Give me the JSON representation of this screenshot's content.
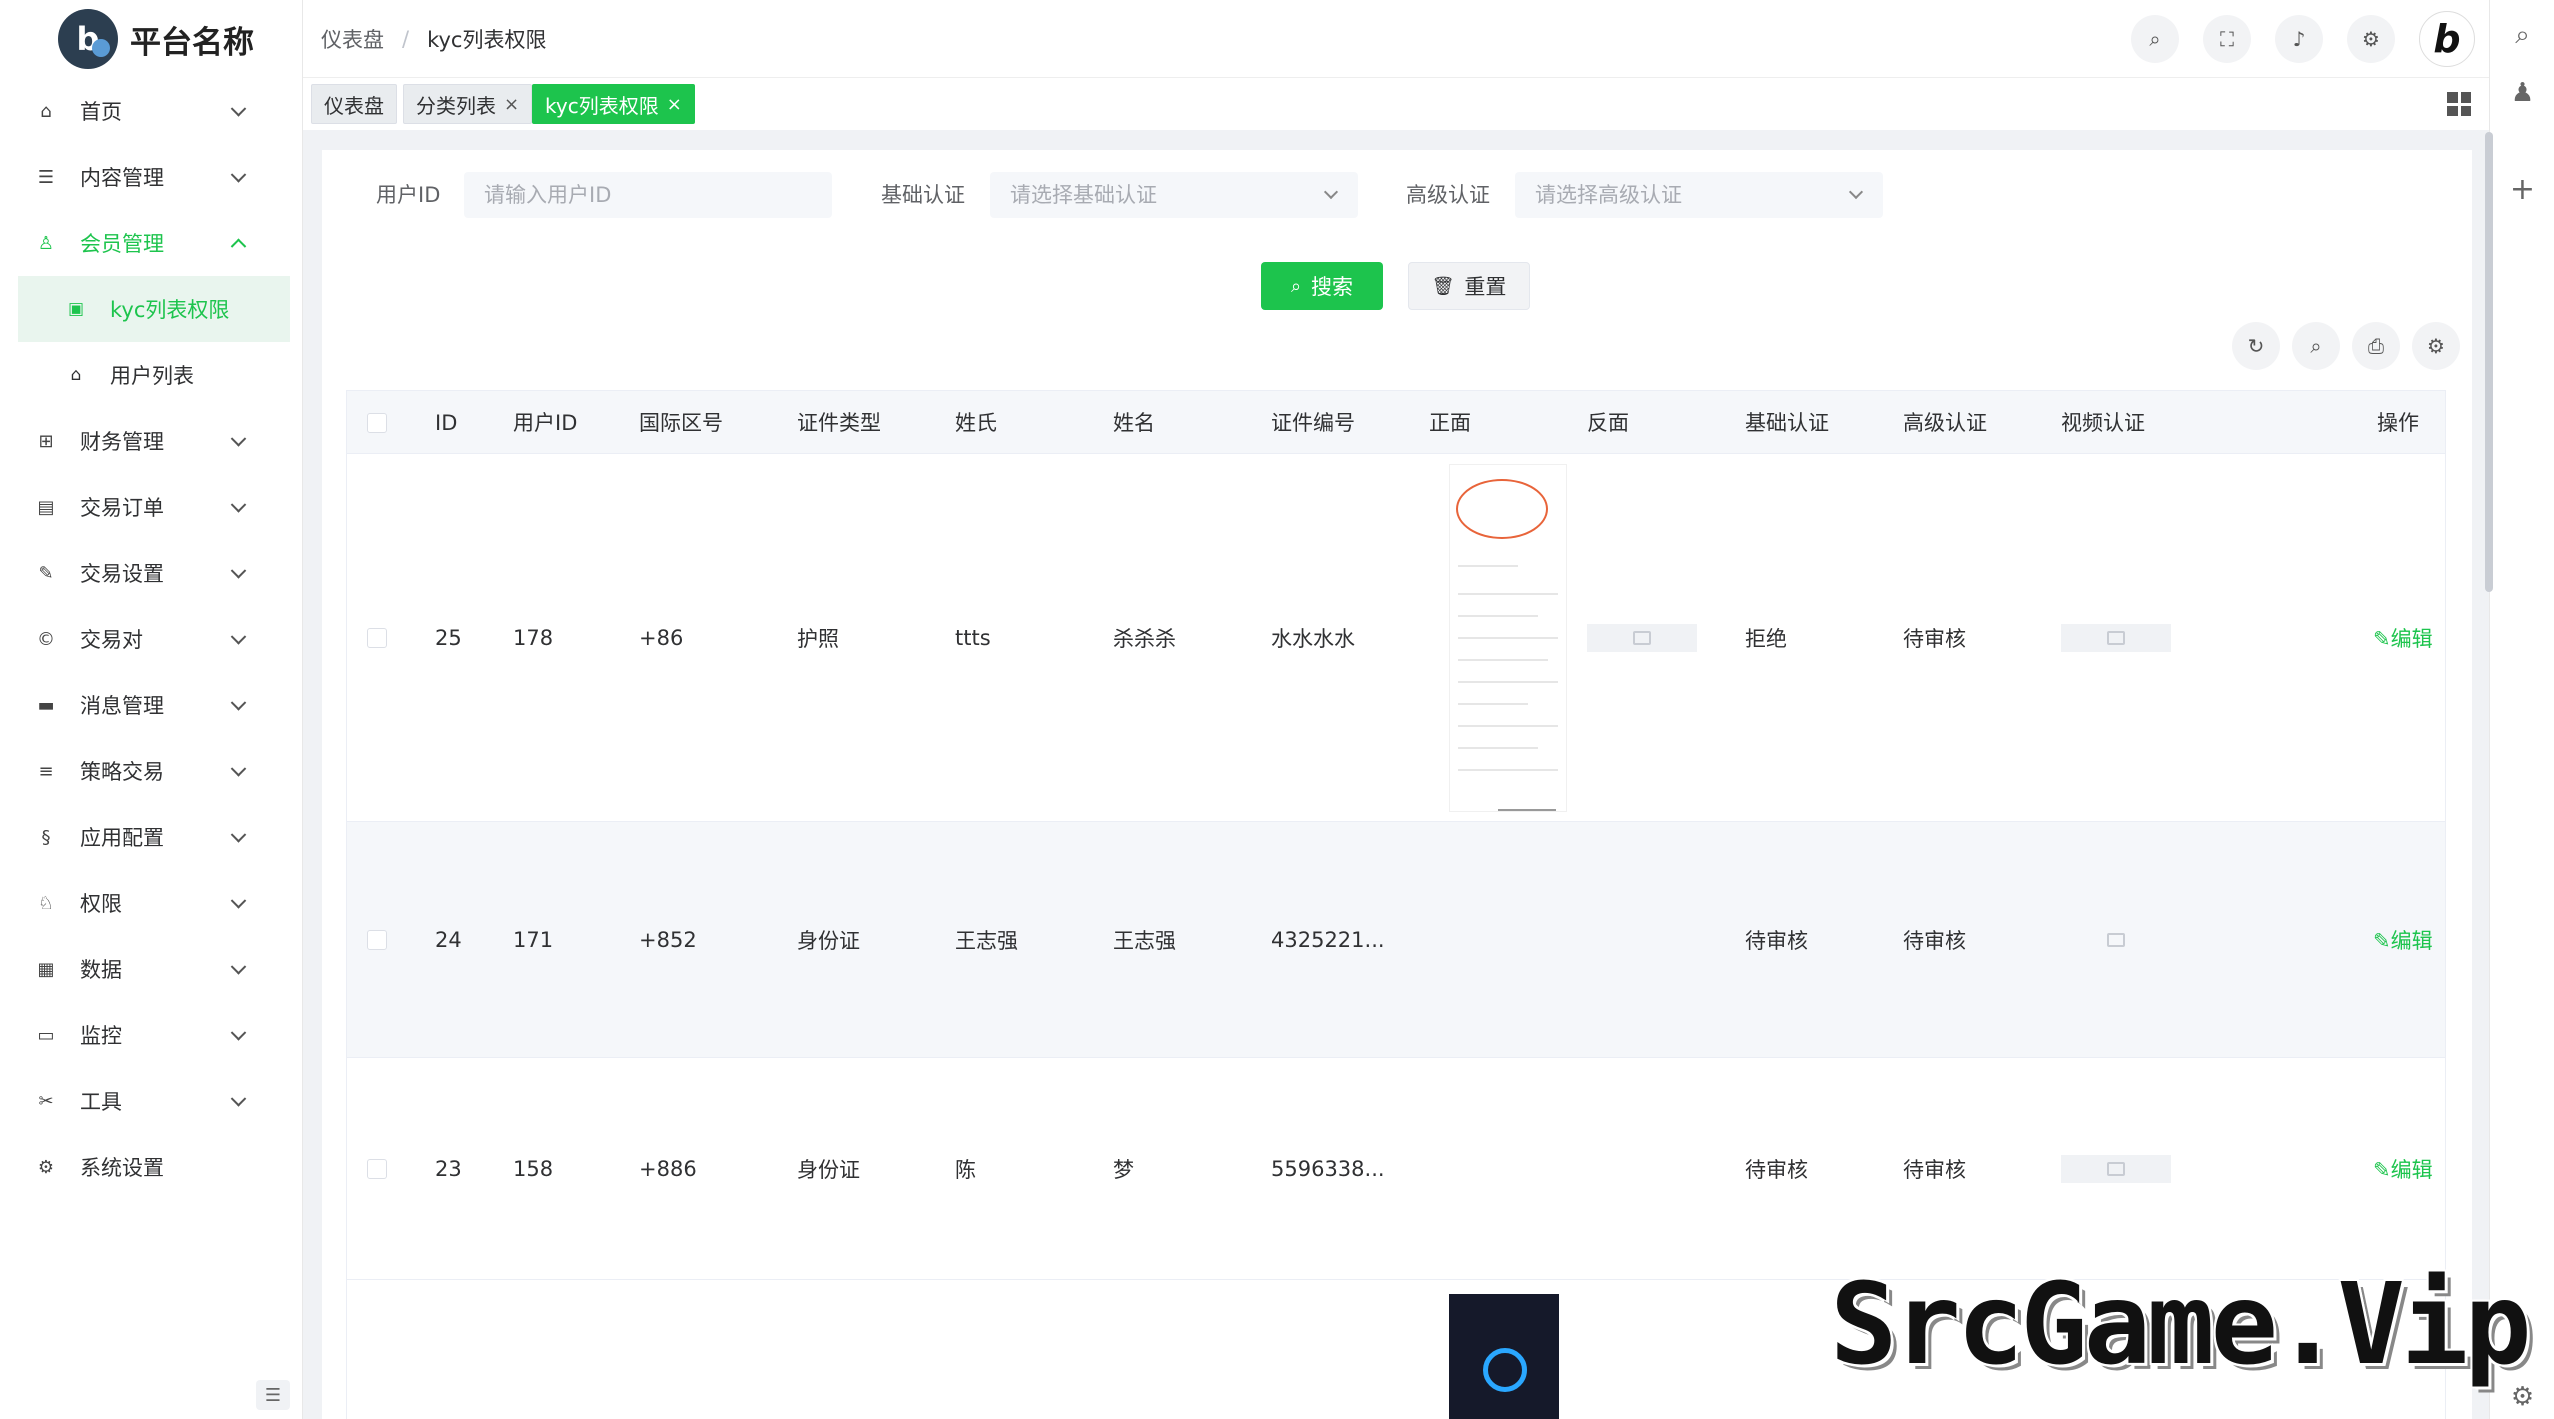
{
  "app": {
    "title": "平台名称",
    "logo_letter": "b"
  },
  "breadcrumb": [
    "仪表盘",
    "kyc列表权限"
  ],
  "sidebar": {
    "items": [
      {
        "label": "首页",
        "icon": "home-icon",
        "glyph": "⌂"
      },
      {
        "label": "内容管理",
        "icon": "list-icon",
        "glyph": "☰"
      },
      {
        "label": "会员管理",
        "icon": "user-icon",
        "glyph": "♙"
      },
      {
        "label": "财务管理",
        "icon": "grid-icon",
        "glyph": "⊞"
      },
      {
        "label": "交易订单",
        "icon": "table-icon",
        "glyph": "▤"
      },
      {
        "label": "交易设置",
        "icon": "wrench-icon",
        "glyph": "✎"
      },
      {
        "label": "交易对",
        "icon": "copyright-icon",
        "glyph": "©"
      },
      {
        "label": "消息管理",
        "icon": "message-icon",
        "glyph": "▬"
      },
      {
        "label": "策略交易",
        "icon": "menu-icon",
        "glyph": "≡"
      },
      {
        "label": "应用配置",
        "icon": "coins-icon",
        "glyph": "§"
      },
      {
        "label": "权限",
        "icon": "user-key-icon",
        "glyph": "♘"
      },
      {
        "label": "数据",
        "icon": "database-icon",
        "glyph": "▦"
      },
      {
        "label": "监控",
        "icon": "monitor-icon",
        "glyph": "▭"
      },
      {
        "label": "工具",
        "icon": "tools-icon",
        "glyph": "✂"
      },
      {
        "label": "系统设置",
        "icon": "gear-icon",
        "glyph": "⚙"
      }
    ],
    "submenu": [
      {
        "label": "kyc列表权限",
        "icon": "book-icon",
        "glyph": "▣"
      },
      {
        "label": "用户列表",
        "icon": "home-icon",
        "glyph": "⌂"
      }
    ]
  },
  "tags": [
    {
      "label": "仪表盘",
      "closable": false
    },
    {
      "label": "分类列表",
      "closable": true
    },
    {
      "label": "kyc列表权限",
      "closable": true
    }
  ],
  "tag_close": "×",
  "filters": {
    "user_id": {
      "label": "用户ID",
      "placeholder": "请输入用户ID"
    },
    "basic": {
      "label": "基础认证",
      "placeholder": "请选择基础认证"
    },
    "advanced": {
      "label": "高级认证",
      "placeholder": "请选择高级认证"
    }
  },
  "buttons": {
    "search": "搜索",
    "reset": "重置"
  },
  "table": {
    "headers": [
      "ID",
      "用户ID",
      "国际区号",
      "证件类型",
      "姓氏",
      "姓名",
      "证件编号",
      "正面",
      "反面",
      "基础认证",
      "高级认证",
      "视频认证",
      "操作"
    ],
    "rows": [
      {
        "id": "25",
        "user_id": "178",
        "area": "+86",
        "doc_type": "护照",
        "surname": "ttts",
        "name": "杀杀杀",
        "doc_no": "水水水水",
        "basic": "拒绝",
        "advanced": "待审核",
        "action": "编辑"
      },
      {
        "id": "24",
        "user_id": "171",
        "area": "+852",
        "doc_type": "身份证",
        "surname": "王志强",
        "name": "王志强",
        "doc_no": "4325221...",
        "basic": "待审核",
        "advanced": "待审核",
        "action": "编辑"
      },
      {
        "id": "23",
        "user_id": "158",
        "area": "+886",
        "doc_type": "身份证",
        "surname": "陈",
        "name": "梦",
        "doc_no": "5596338...",
        "basic": "待审核",
        "advanced": "待审核",
        "action": "编辑"
      }
    ]
  },
  "watermark": "SrcGame.Vip",
  "colors": {
    "accent": "#1dc44d",
    "header_bg": "#f5f7fa"
  }
}
